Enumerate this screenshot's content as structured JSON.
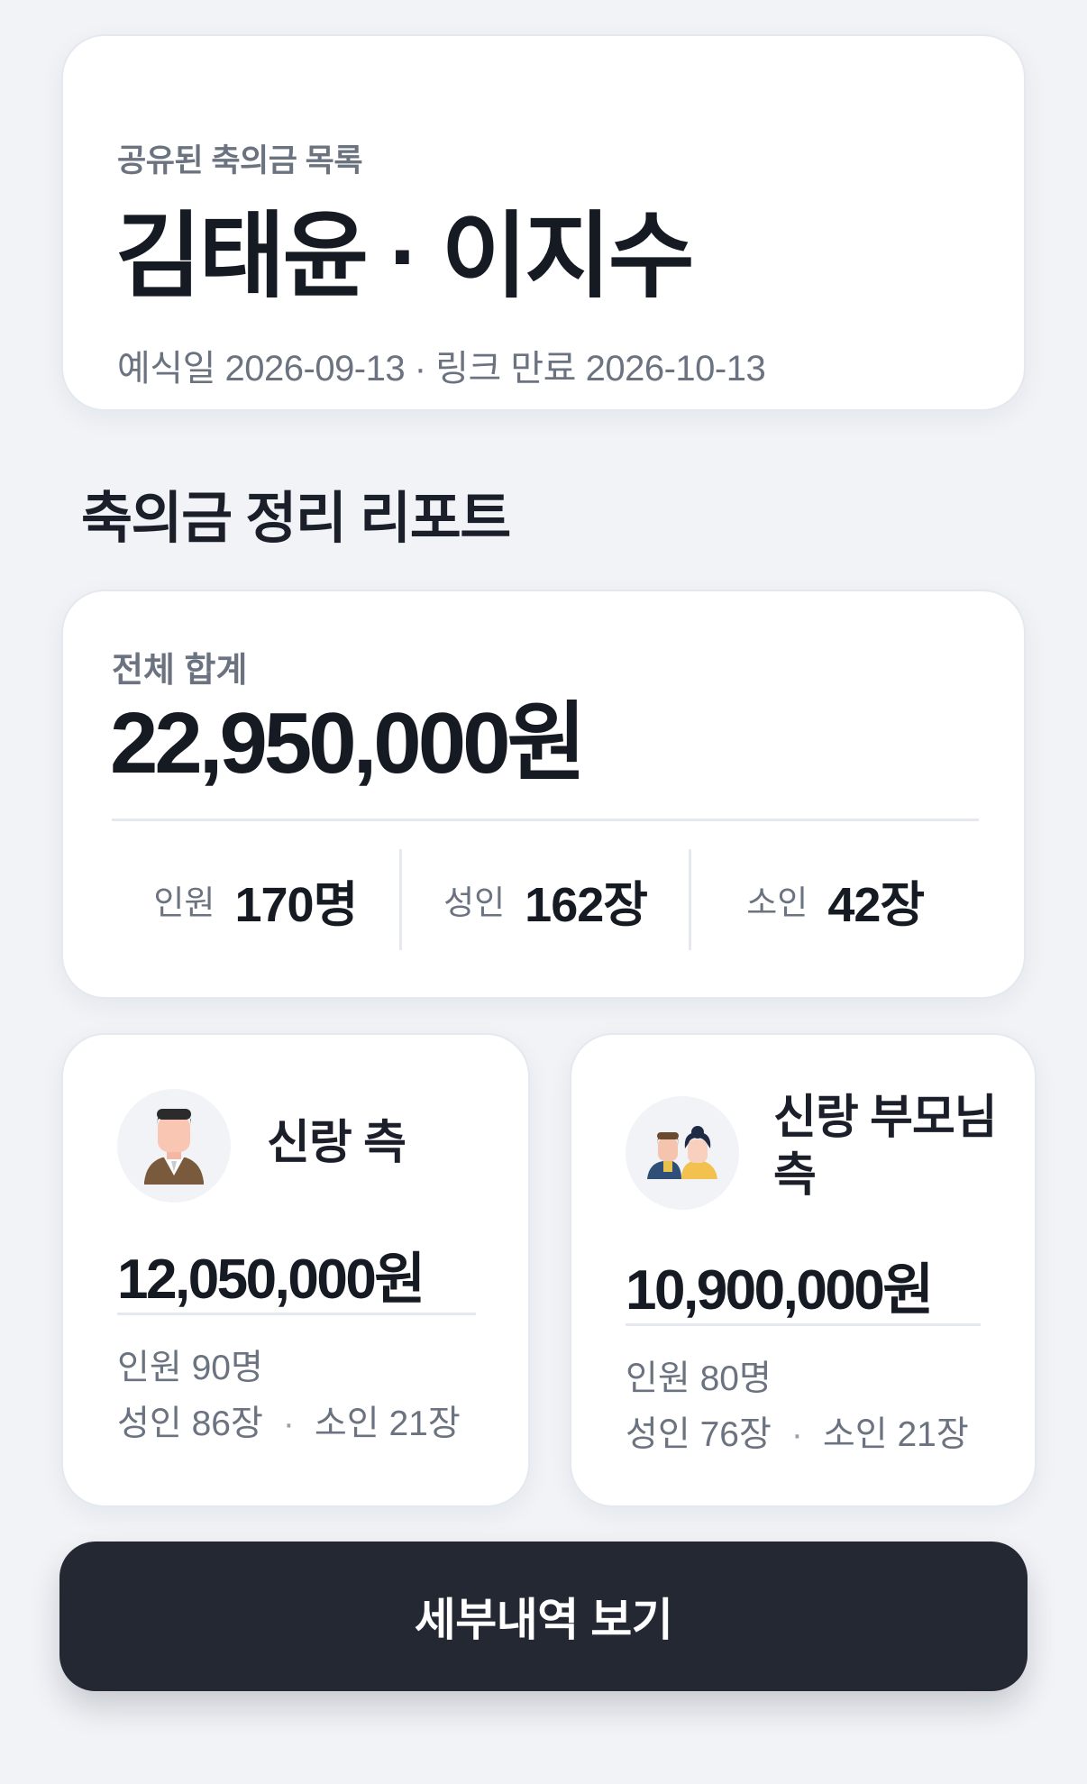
{
  "header": {
    "eyebrow": "공유된 축의금 목록",
    "couple": "김태윤 · 이지수",
    "meta": "예식일 2026-09-13 · 링크 만료 2026-10-13"
  },
  "section_title": "축의금 정리 리포트",
  "total": {
    "label": "전체 합계",
    "amount": "22,950,000원",
    "stats": [
      {
        "label": "인원",
        "value": "170명"
      },
      {
        "label": "성인",
        "value": "162장"
      },
      {
        "label": "소인",
        "value": "42장"
      }
    ]
  },
  "groom_side": {
    "icon": "groom-avatar-icon",
    "title": "신랑 측",
    "amount": "12,050,000원",
    "people": "인원 90명",
    "adults": "성인 86장",
    "children": "소인 21장"
  },
  "groom_parents_side": {
    "icon": "parents-avatar-icon",
    "title": "신랑 부모님 측",
    "amount": "10,900,000원",
    "people": "인원 80명",
    "adults": "성인 76장",
    "children": "소인 21장"
  },
  "separator": "·",
  "cta_label": "세부내역 보기",
  "colors": {
    "background": "#f1f3f7",
    "card": "#ffffff",
    "text_primary": "#151a23",
    "text_secondary": "#6b7280",
    "button": "#242833"
  }
}
